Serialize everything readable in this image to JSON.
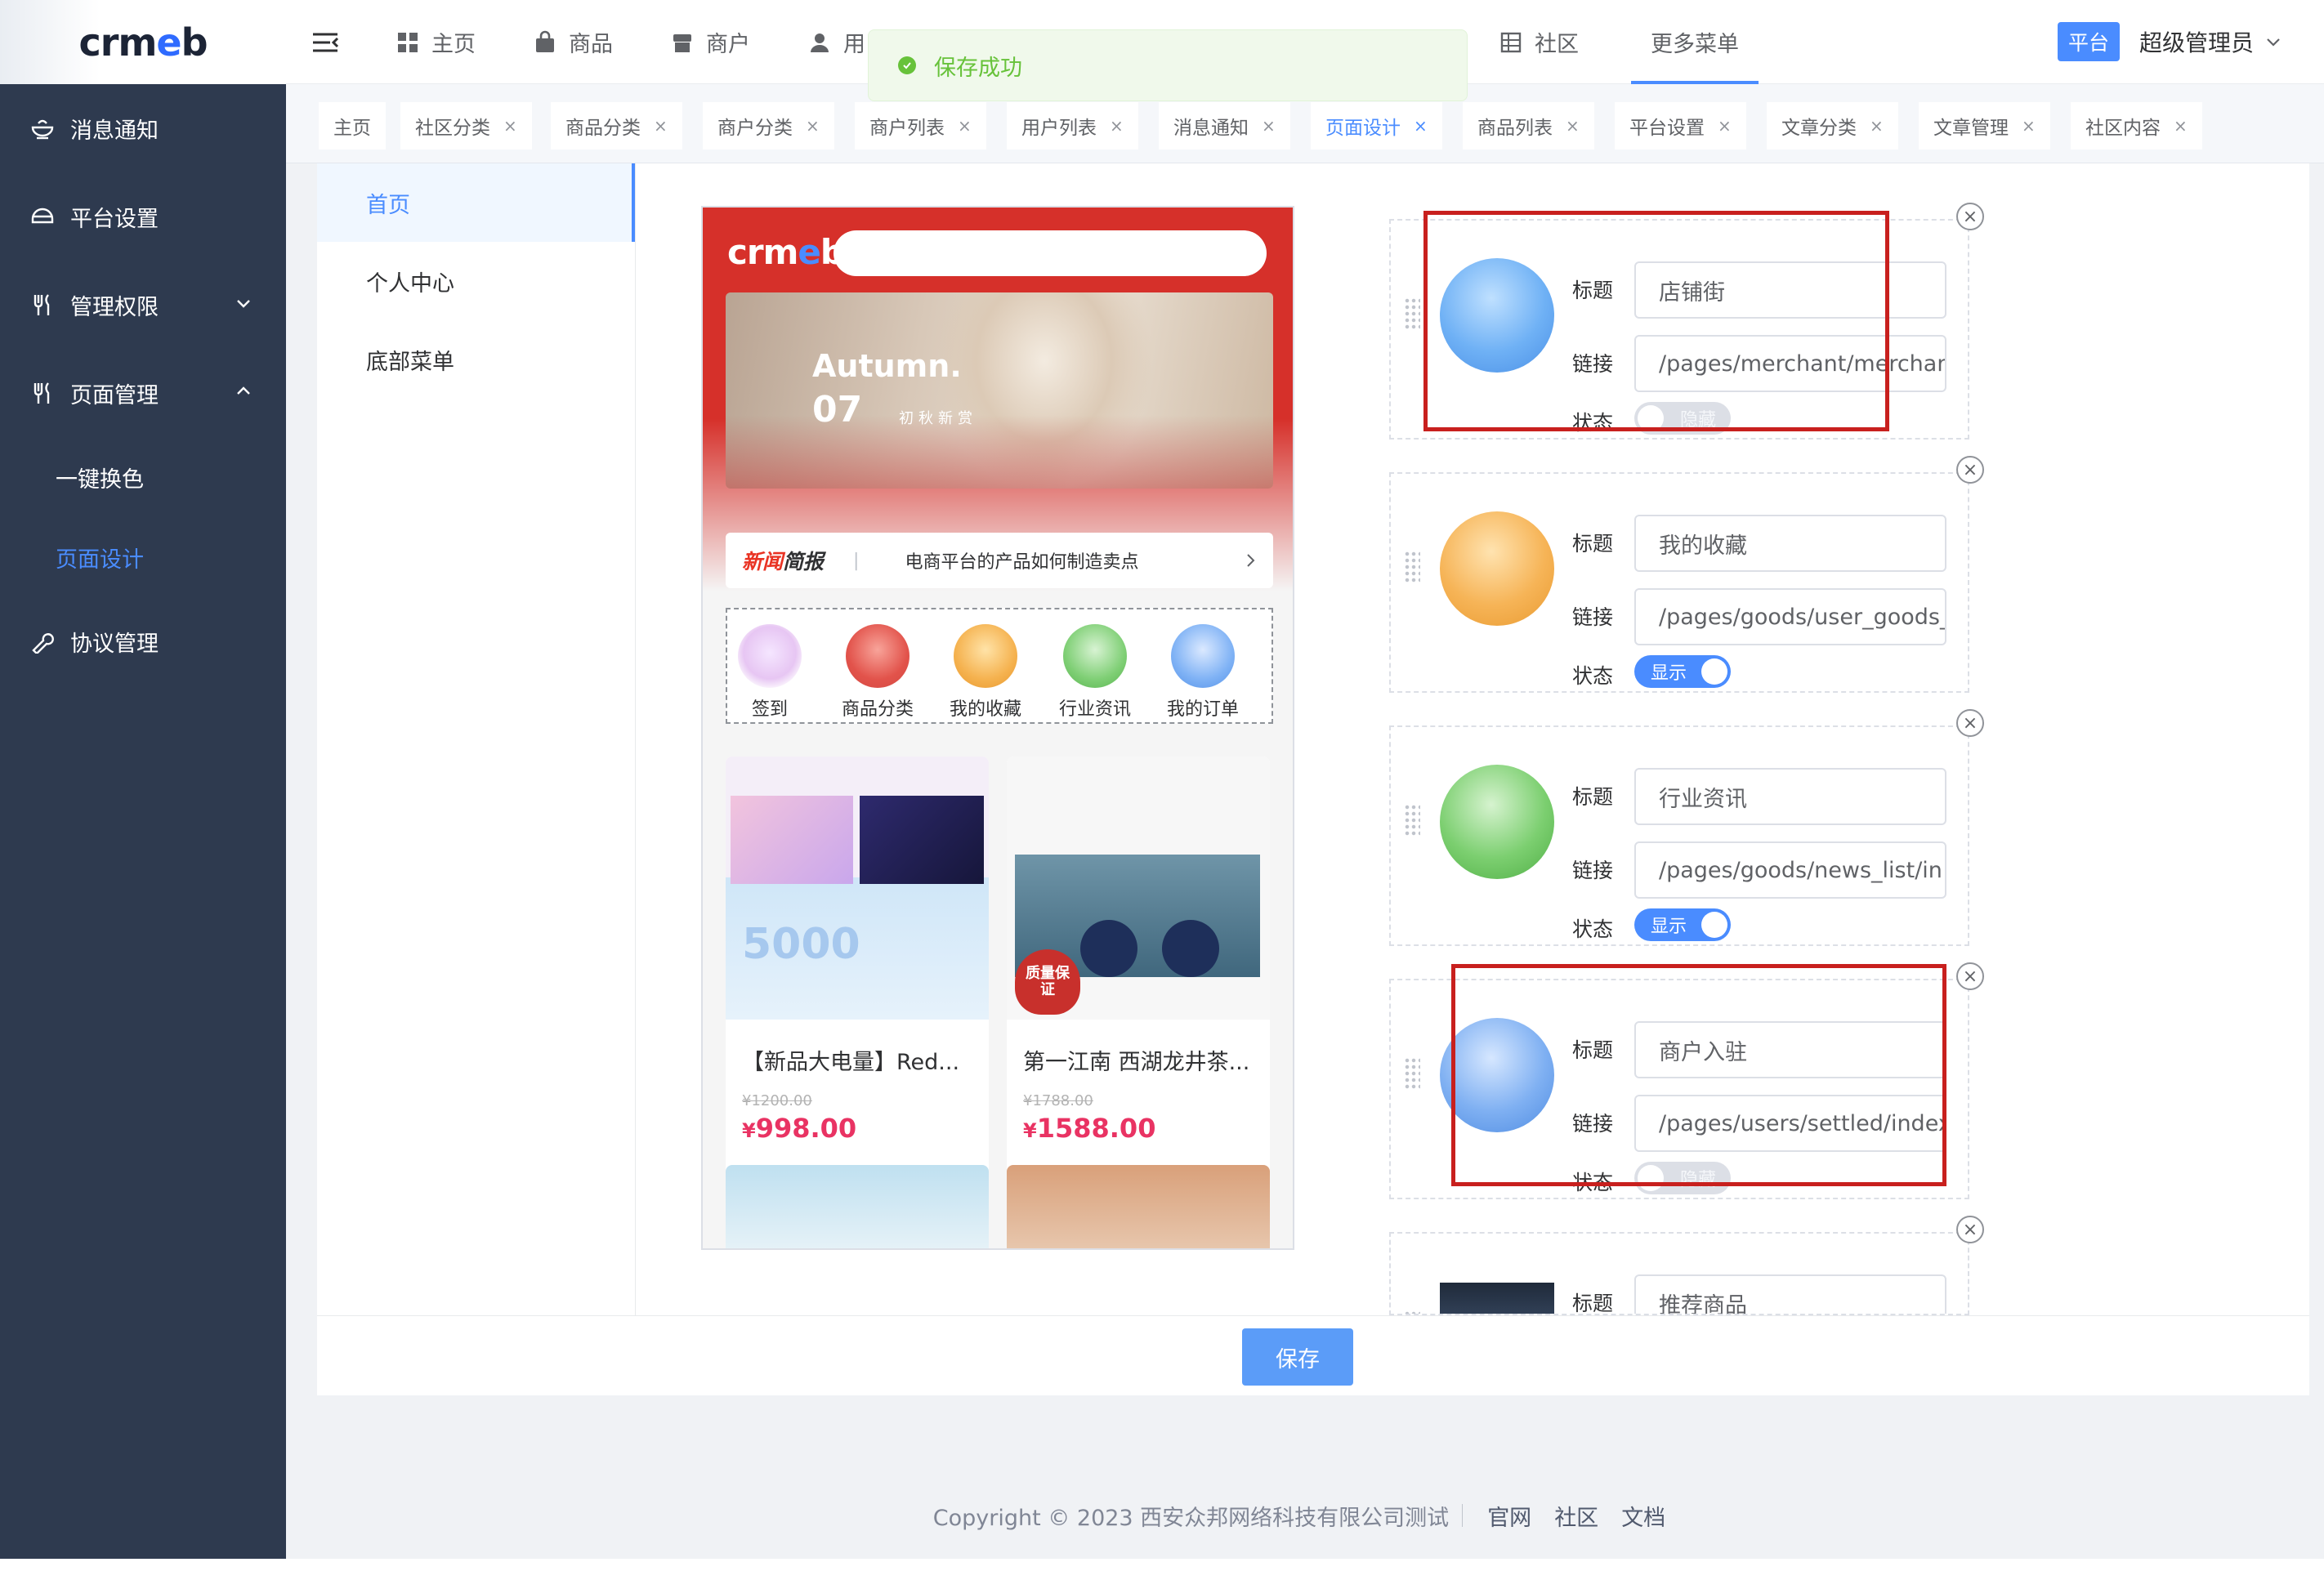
{
  "brand": {
    "logo_text_a": "crm",
    "logo_text_e": "e",
    "logo_text_b": "b"
  },
  "sidebar": {
    "items": [
      {
        "label": "消息通知",
        "icon": "bell-bowl-icon"
      },
      {
        "label": "平台设置",
        "icon": "helmet-icon"
      },
      {
        "label": "管理权限",
        "icon": "cutlery-icon",
        "expanded": false
      },
      {
        "label": "页面管理",
        "icon": "cutlery-icon",
        "expanded": true
      },
      {
        "label": "协议管理",
        "icon": "wrench-icon"
      }
    ],
    "sub_items": [
      {
        "label": "一键换色",
        "active": false
      },
      {
        "label": "页面设计",
        "active": true
      }
    ]
  },
  "header": {
    "nav": [
      {
        "label": "主页",
        "icon": "grid-icon"
      },
      {
        "label": "商品",
        "icon": "bag-icon"
      },
      {
        "label": "商户",
        "icon": "shop-icon"
      },
      {
        "label": "用",
        "icon": "user-icon"
      },
      {
        "label": "社区",
        "icon": "building-icon"
      },
      {
        "label": "更多菜单",
        "icon": ""
      }
    ],
    "platform_label": "平台",
    "admin_label": "超级管理员"
  },
  "toast": {
    "message": "保存成功",
    "color": "#67c23a"
  },
  "tabs": [
    {
      "label": "主页",
      "closable": false
    },
    {
      "label": "社区分类",
      "closable": true
    },
    {
      "label": "商品分类",
      "closable": true
    },
    {
      "label": "商户分类",
      "closable": true
    },
    {
      "label": "商户列表",
      "closable": true
    },
    {
      "label": "用户列表",
      "closable": true
    },
    {
      "label": "消息通知",
      "closable": true
    },
    {
      "label": "页面设计",
      "closable": true,
      "active": true
    },
    {
      "label": "商品列表",
      "closable": true
    },
    {
      "label": "平台设置",
      "closable": true
    },
    {
      "label": "文章分类",
      "closable": true
    },
    {
      "label": "文章管理",
      "closable": true
    },
    {
      "label": "社区内容",
      "closable": true
    }
  ],
  "tab_close_glyph": "×",
  "page_menu": [
    {
      "label": "首页",
      "active": true
    },
    {
      "label": "个人中心",
      "active": false
    },
    {
      "label": "底部菜单",
      "active": false
    }
  ],
  "phone": {
    "banner": {
      "title": "Autumn.",
      "num": "07",
      "sub": "初秋新赏"
    },
    "news": {
      "tag_a": "新闻",
      "tag_b": "简报",
      "sep": "|",
      "text": "电商平台的产品如何制造卖点"
    },
    "icons": [
      {
        "label": "签到"
      },
      {
        "label": "商品分类"
      },
      {
        "label": "我的收藏"
      },
      {
        "label": "行业资讯"
      },
      {
        "label": "我的订单"
      }
    ],
    "products": [
      {
        "name": "【新品大电量】Red...",
        "old_price": "¥1200.00",
        "price_symbol": "¥",
        "price": "998.00",
        "img_text": "5000"
      },
      {
        "name": "第一江南 西湖龙井茶...",
        "old_price": "¥1788.00",
        "price_symbol": "¥",
        "price": "1588.00",
        "img_text": "质量保证"
      }
    ]
  },
  "config": {
    "labels": {
      "title": "标题",
      "link": "链接",
      "status": "状态"
    },
    "items": [
      {
        "title": "店铺街",
        "link": "/pages/merchant/merchan",
        "status": "隐藏",
        "on": false,
        "icon": "store-icon"
      },
      {
        "title": "我的收藏",
        "link": "/pages/goods/user_goods_",
        "status": "显示",
        "on": true,
        "icon": "favorite-box-icon"
      },
      {
        "title": "行业资讯",
        "link": "/pages/goods/news_list/in",
        "status": "显示",
        "on": true,
        "icon": "news-mail-icon"
      },
      {
        "title": "商户入驻",
        "link": "/pages/users/settled/index",
        "status": "隐藏",
        "on": false,
        "icon": "merchant-apply-icon"
      },
      {
        "title": "推荐商品",
        "link": "",
        "status": "",
        "on": false,
        "icon": "recommend-thumb-icon"
      }
    ],
    "close_glyph": "×"
  },
  "save_label": "保存",
  "footer": {
    "copyright": "Copyright © 2023 西安众邦网络科技有限公司测试",
    "links": [
      "官网",
      "社区",
      "文档"
    ]
  }
}
